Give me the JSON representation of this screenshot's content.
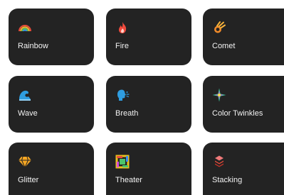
{
  "effects": [
    {
      "label": "Rainbow",
      "icon": "rainbow-icon"
    },
    {
      "label": "Fire",
      "icon": "fire-icon"
    },
    {
      "label": "Comet",
      "icon": "comet-icon"
    },
    {
      "label": "Wave",
      "icon": "wave-icon"
    },
    {
      "label": "Breath",
      "icon": "breath-icon"
    },
    {
      "label": "Color Twinkles",
      "icon": "twinkle-icon"
    },
    {
      "label": "Glitter",
      "icon": "glitter-icon"
    },
    {
      "label": "Theater",
      "icon": "theater-icon"
    },
    {
      "label": "Stacking",
      "icon": "stacking-icon"
    }
  ],
  "colors": {
    "tile_background": "#232323",
    "label_text": "#f2f2f2",
    "page_background": "#ffffff"
  }
}
